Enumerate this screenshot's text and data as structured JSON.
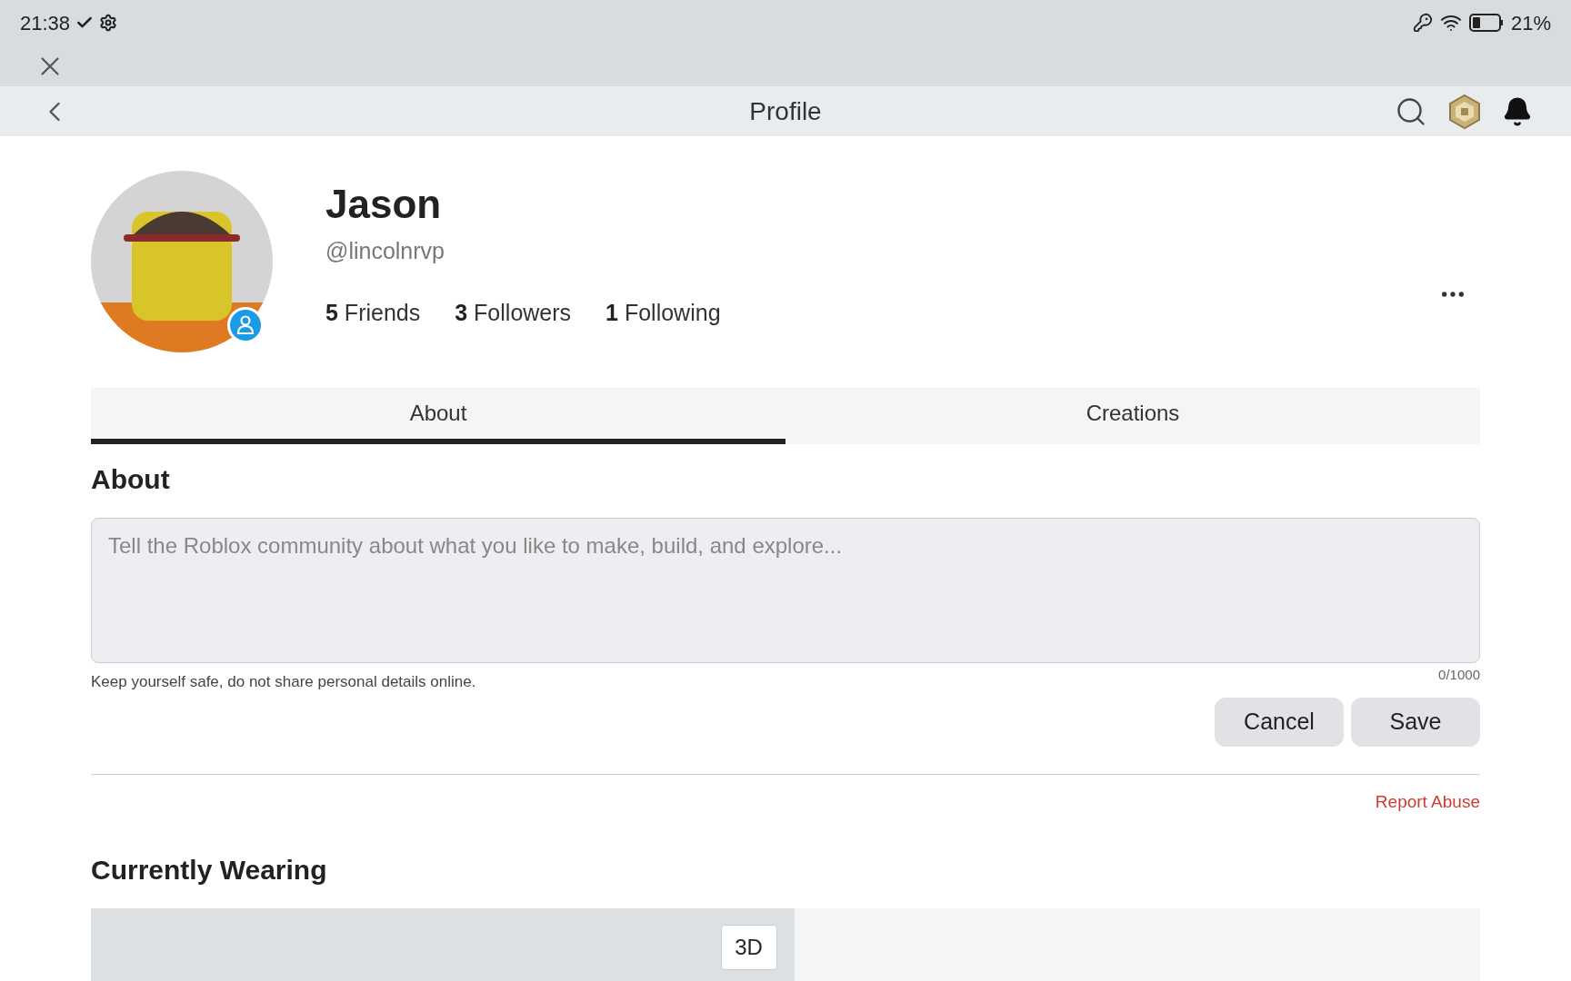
{
  "status_bar": {
    "time": "21:38",
    "battery": "21%"
  },
  "header": {
    "title": "Profile"
  },
  "profile": {
    "display_name": "Jason",
    "handle": "@lincolnrvp",
    "stats": [
      {
        "count": "5",
        "label": "Friends"
      },
      {
        "count": "3",
        "label": "Followers"
      },
      {
        "count": "1",
        "label": "Following"
      }
    ]
  },
  "tabs": [
    {
      "label": "About",
      "selected": true
    },
    {
      "label": "Creations",
      "selected": false
    }
  ],
  "about": {
    "heading": "About",
    "placeholder": "Tell the Roblox community about what you like to make, build, and explore...",
    "hint": "Keep yourself safe, do not share personal details online.",
    "counter": "0/1000",
    "buttons": [
      "Cancel",
      "Save"
    ]
  },
  "report_link": "Report Abuse",
  "wearing": {
    "heading": "Currently Wearing",
    "view_button": "3D"
  }
}
